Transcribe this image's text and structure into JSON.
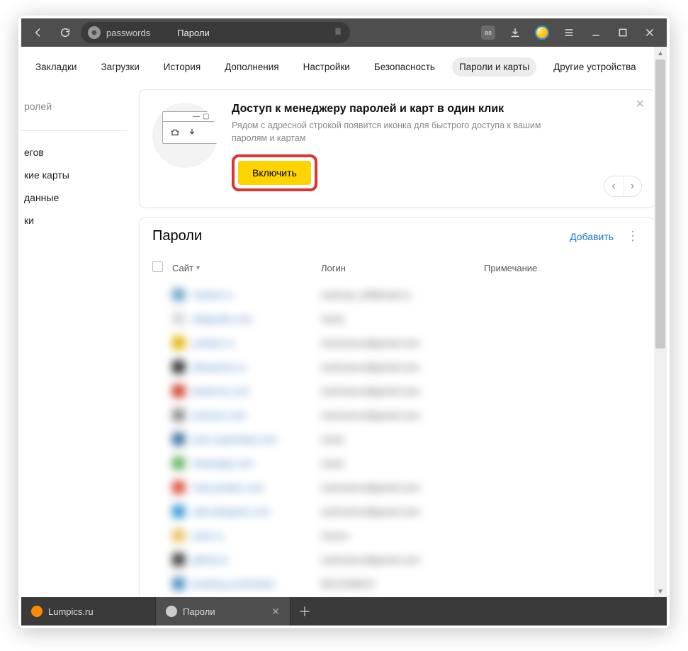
{
  "chrome": {
    "address_keyword": "passwords",
    "address_title": "Пароли"
  },
  "navtabs": [
    "Закладки",
    "Загрузки",
    "История",
    "Дополнения",
    "Настройки",
    "Безопасность",
    "Пароли и карты",
    "Другие устройства"
  ],
  "navtabs_active_index": 6,
  "sidebar": {
    "search_placeholder": "ролей",
    "items": [
      "егов",
      "кие карты",
      "данные",
      "ки"
    ]
  },
  "promo": {
    "title": "Доступ к менеджеру паролей и карт в один клик",
    "desc": "Рядом с адресной строкой появится иконка для быстрого доступа к вашим паролям и картам",
    "button": "Включить"
  },
  "panel": {
    "title": "Пароли",
    "add": "Добавить",
    "cols": {
      "site": "Сайт",
      "login": "Логин",
      "note": "Примечание"
    }
  },
  "rows": [
    {
      "fav": "#6fa5c7",
      "site": "market.ru",
      "login": "ivanivan_89@mail.ru"
    },
    {
      "fav": "#d8d8d8",
      "site": "wikipedia.com",
      "login": "Ivane"
    },
    {
      "fav": "#e3b400",
      "site": "yandex.ru",
      "login": "ivanivanov@gmail.com"
    },
    {
      "fav": "#2a2a2a",
      "site": "aliexpress.ru",
      "login": "ivanivanov@gmail.com"
    },
    {
      "fav": "#d03a2a",
      "site": "pinterest.com",
      "login": "ivanivanov@gmail.com"
    },
    {
      "fav": "#8a8a8a",
      "site": "amazon.com",
      "login": "ivanivanov@gmail.com"
    },
    {
      "fav": "#3a6fa0",
      "site": "auto-superdata.com",
      "login": "Ivane"
    },
    {
      "fav": "#60b360",
      "site": "whatsapp.com",
      "login": "Ivane"
    },
    {
      "fav": "#d84b3a",
      "site": "mail.yandex.com",
      "login": "ivanivanov@gmail.com"
    },
    {
      "fav": "#3598d4",
      "site": "web.telegram.com",
      "login": "ivanivanov@gmail.com"
    },
    {
      "fav": "#e8c060",
      "site": "avito.ru",
      "login": "Ivanov"
    },
    {
      "fav": "#3a3a3a",
      "site": "github.io",
      "login": "ivanivanov@gmail.com"
    },
    {
      "fav": "#4a8fc0",
      "site": "booking.com/hotels",
      "login": "8912348819"
    }
  ],
  "tabs": [
    {
      "label": "Lumpics.ru",
      "favcolor": "#ff8a00",
      "active": false
    },
    {
      "label": "Пароли",
      "favcolor": "#ccc",
      "active": true
    }
  ]
}
